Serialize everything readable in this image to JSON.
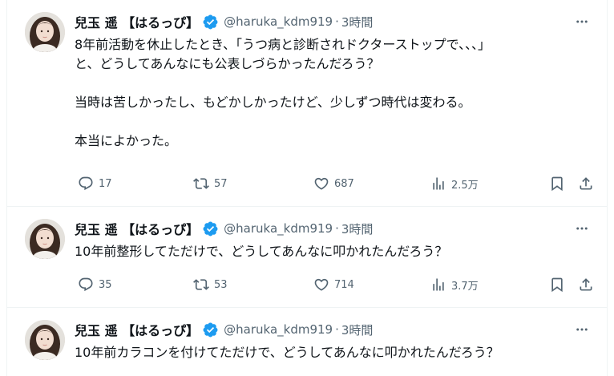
{
  "tweets": [
    {
      "name": "兒玉 遥 【はるっぴ】",
      "handle": "@haruka_kdm919",
      "separator": "·",
      "time": "3時間",
      "text": "8年前活動を休止したとき、「うつ病と診断されドクターストップで、、、」\nと、どうしてあんなにも公表しづらかったんだろう？\n\n当時は苦しかったし、もどかしかったけど、少しずつ時代は変わる。\n\n本当によかった。",
      "replies": "17",
      "retweets": "57",
      "likes": "687",
      "views": "2.5万"
    },
    {
      "name": "兒玉 遥 【はるっぴ】",
      "handle": "@haruka_kdm919",
      "separator": "·",
      "time": "3時間",
      "text": "10年前整形してただけで、どうしてあんなに叩かれたんだろう？",
      "replies": "35",
      "retweets": "53",
      "likes": "714",
      "views": "3.7万"
    },
    {
      "name": "兒玉 遥 【はるっぴ】",
      "handle": "@haruka_kdm919",
      "separator": "·",
      "time": "3時間",
      "text": "10年前カラコンを付けてただけで、どうしてあんなに叩かれたんだろう？"
    }
  ],
  "colors": {
    "verified_blue": "#1d9bf0",
    "muted_text": "#536471",
    "main_text": "#0f1419",
    "border": "#eff3f4"
  },
  "icons": {
    "reply": "reply-icon",
    "retweet": "retweet-icon",
    "like": "heart-icon",
    "views": "views-chart-icon",
    "bookmark": "bookmark-icon",
    "share": "share-icon",
    "more": "more-dots-icon",
    "verified": "verified-badge-icon"
  }
}
